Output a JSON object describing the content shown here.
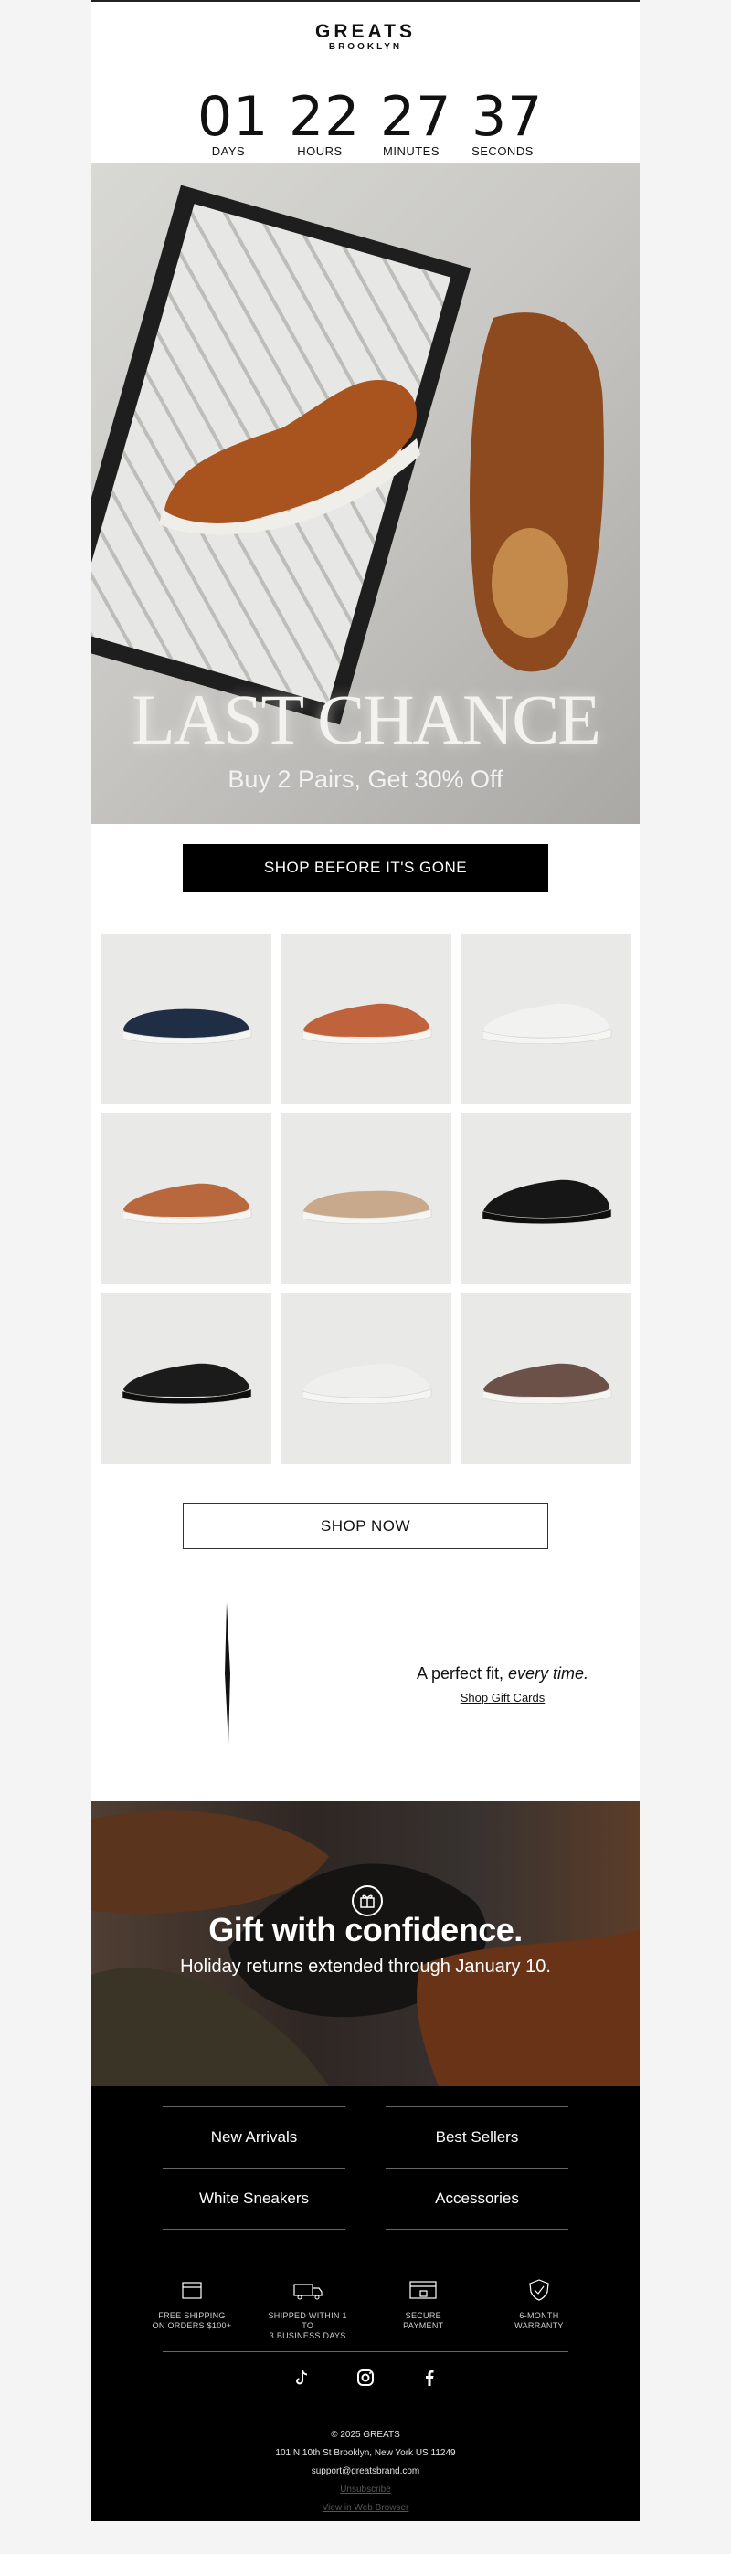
{
  "brand": {
    "line1": "GREATS",
    "line2": "BROOKLYN"
  },
  "countdown": [
    {
      "value": "01",
      "label": "DAYS"
    },
    {
      "value": "22",
      "label": "HOURS"
    },
    {
      "value": "27",
      "label": "MINUTES"
    },
    {
      "value": "37",
      "label": "SECONDS"
    }
  ],
  "hero": {
    "title": "LAST CHANCE",
    "subtitle": "Buy 2 Pairs, Get 30% Off"
  },
  "cta_primary": "SHOP BEFORE IT'S GONE",
  "products": [
    {
      "color": "#1f2d45",
      "kind": "loafer"
    },
    {
      "color": "#c0623b",
      "kind": "sneaker"
    },
    {
      "color": "#f2f2f0",
      "kind": "sneaker"
    },
    {
      "color": "#b9673c",
      "kind": "sneaker"
    },
    {
      "color": "#c9a98c",
      "kind": "slipon"
    },
    {
      "color": "#161616",
      "kind": "runner"
    },
    {
      "color": "#1b1b1b",
      "kind": "sneaker"
    },
    {
      "color": "#efefed",
      "kind": "sneaker"
    },
    {
      "color": "#6b5148",
      "kind": "sneaker"
    }
  ],
  "cta_secondary": "SHOP NOW",
  "gift": {
    "line_prefix": "A perfect fit,",
    "line_italic": "every time.",
    "link": "Shop Gift Cards"
  },
  "banner": {
    "headline": "Gift with confidence.",
    "subline": "Holiday returns extended through January 10."
  },
  "footer": {
    "nav": [
      "New Arrivals",
      "Best Sellers",
      "White Sneakers",
      "Accessories"
    ],
    "perks": [
      {
        "icon": "box-icon",
        "line1": "FREE SHIPPING",
        "line2": "ON ORDERS $100+"
      },
      {
        "icon": "truck-icon",
        "line1": "SHIPPED WITHIN 1 TO",
        "line2": "3 BUSINESS DAYS"
      },
      {
        "icon": "lock-card-icon",
        "line1": "SECURE",
        "line2": "PAYMENT"
      },
      {
        "icon": "shield-check-icon",
        "line1": "6-MONTH",
        "line2": "WARRANTY"
      }
    ],
    "social": [
      "tiktok-icon",
      "instagram-icon",
      "facebook-icon"
    ],
    "copyright": "© 2025 GREATS",
    "address": "101 N 10th St Brooklyn, New York US 11249",
    "email": "support@greatsbrand.com",
    "unsubscribe": "Unsubscribe",
    "view_browser": "View in Web Browser"
  }
}
